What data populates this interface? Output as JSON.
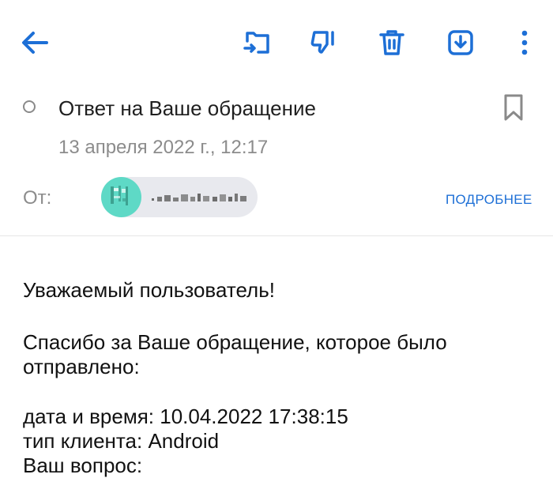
{
  "toolbar": {
    "back_icon": "arrow-left-icon",
    "move_icon": "folder-move-icon",
    "spam_icon": "thumbs-down-icon",
    "delete_icon": "trash-icon",
    "save_icon": "download-icon",
    "more_icon": "more-vertical-icon",
    "accent_color": "#1d6fd6"
  },
  "header": {
    "subject": "Ответ на Ваше обращение",
    "date": "13 апреля 2022 г., 12:17",
    "from_label": "От:",
    "sender_name": ".x&lt;%#(r.&amp;",
    "details_label": "ПОДРОБНЕЕ",
    "bookmark_icon": "bookmark-icon"
  },
  "body": {
    "greeting": "Уважаемый пользователь!",
    "thanks": "Спасибо за Ваше обращение, которое было отправлено:",
    "datetime": "дата и время: 10.04.2022 17:38:15",
    "client_type": "тип клиента: Android",
    "question": "Ваш вопрос:"
  }
}
